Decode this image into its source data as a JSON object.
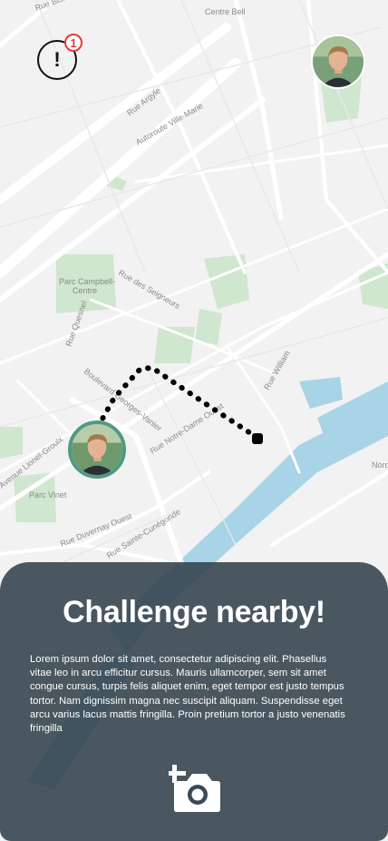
{
  "map": {
    "labels": {
      "bishop": "Rue Bishop",
      "centre_bell": "Centre Bell",
      "argyle": "Rue Argyle",
      "ville_marie": "Autoroute Ville-Marie",
      "parc_campbell": "Parc Campbell-",
      "parc_campbell_2": "Centre",
      "seigneurs": "Rue des Seigneurs",
      "quesnel": "Rue Quesnel",
      "georges_vanier": "Boulevard Georges-Vanier",
      "notre_dame": "Rue Notre-Dame Ouest",
      "william": "Rue William",
      "lionel_groulx": "Avenue Lionel-Groulx",
      "parc_vinet": "Parc Vinet",
      "duvernay": "Rue Duvernay Ouest",
      "cunegonde": "Rue Sainte-Cunégonde",
      "nord": "Nord"
    }
  },
  "alert": {
    "icon": "alert-icon",
    "symbol": "!",
    "badge_count": "1"
  },
  "challenge": {
    "title": "Challenge nearby!",
    "description": "Lorem ipsum dolor sit amet, consectetur adipiscing elit. Phasellus vitae leo in arcu efficitur cursus. Mauris ullamcorper, sem sit amet congue cursus, turpis felis aliquet enim, eget tempor est justo tempus tortor. Nam dignissim magna nec suscipit aliquam. Suspendisse eget arcu varius lacus mattis fringilla. Proin pretium tortor a justo venenatis fringilla"
  },
  "camera": {
    "icon": "add-photo-icon"
  },
  "colors": {
    "panel": "#2e3e48",
    "park": "#cfe6cf",
    "water": "#a9d3e6",
    "badge": "#e53935",
    "avatar_ring": "#4f9a82"
  }
}
